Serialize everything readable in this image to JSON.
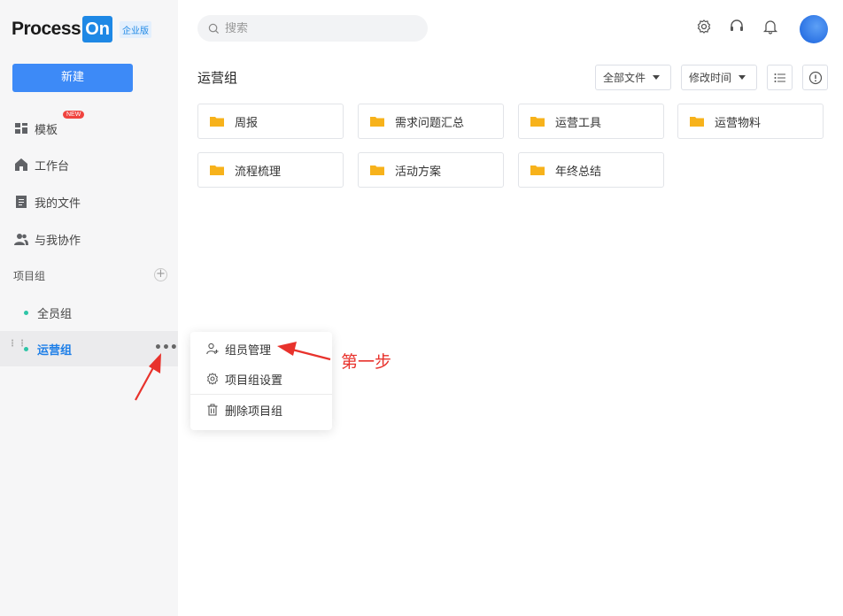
{
  "brand": {
    "name_part1": "Process",
    "name_part2": "On",
    "edition": "企业版"
  },
  "sidebar": {
    "new_button": "新建",
    "nav": [
      {
        "label": "模板",
        "icon": "template-grid-icon",
        "badge": "NEW"
      },
      {
        "label": "工作台",
        "icon": "home-icon"
      },
      {
        "label": "我的文件",
        "icon": "file-icon"
      },
      {
        "label": "与我协作",
        "icon": "users-icon"
      }
    ],
    "section_label": "项目组",
    "section_add": "+",
    "groups": [
      {
        "label": "全员组",
        "active": false
      },
      {
        "label": "运营组",
        "active": true
      }
    ]
  },
  "topbar": {
    "search_placeholder": "搜索",
    "icons": [
      "gear-icon",
      "headset-icon",
      "bell-icon"
    ]
  },
  "main": {
    "title": "运营组",
    "filter_all": "全部文件",
    "sort_by": "修改时间",
    "folders": [
      "周报",
      "需求问题汇总",
      "运营工具",
      "运营物料",
      "流程梳理",
      "活动方案",
      "年终总结"
    ]
  },
  "context_menu": {
    "items": [
      {
        "label": "组员管理",
        "icon": "add-user-icon"
      },
      {
        "label": "项目组设置",
        "icon": "gear-icon"
      },
      {
        "label": "删除项目组",
        "icon": "trash-icon"
      }
    ]
  },
  "annotation": {
    "text": "第一步",
    "color": "#e8322c"
  },
  "colors": {
    "accent": "#3d8af7",
    "folder": "#f7b21b",
    "active_text": "#1e7fe8",
    "dot": "#2ec5a7"
  }
}
